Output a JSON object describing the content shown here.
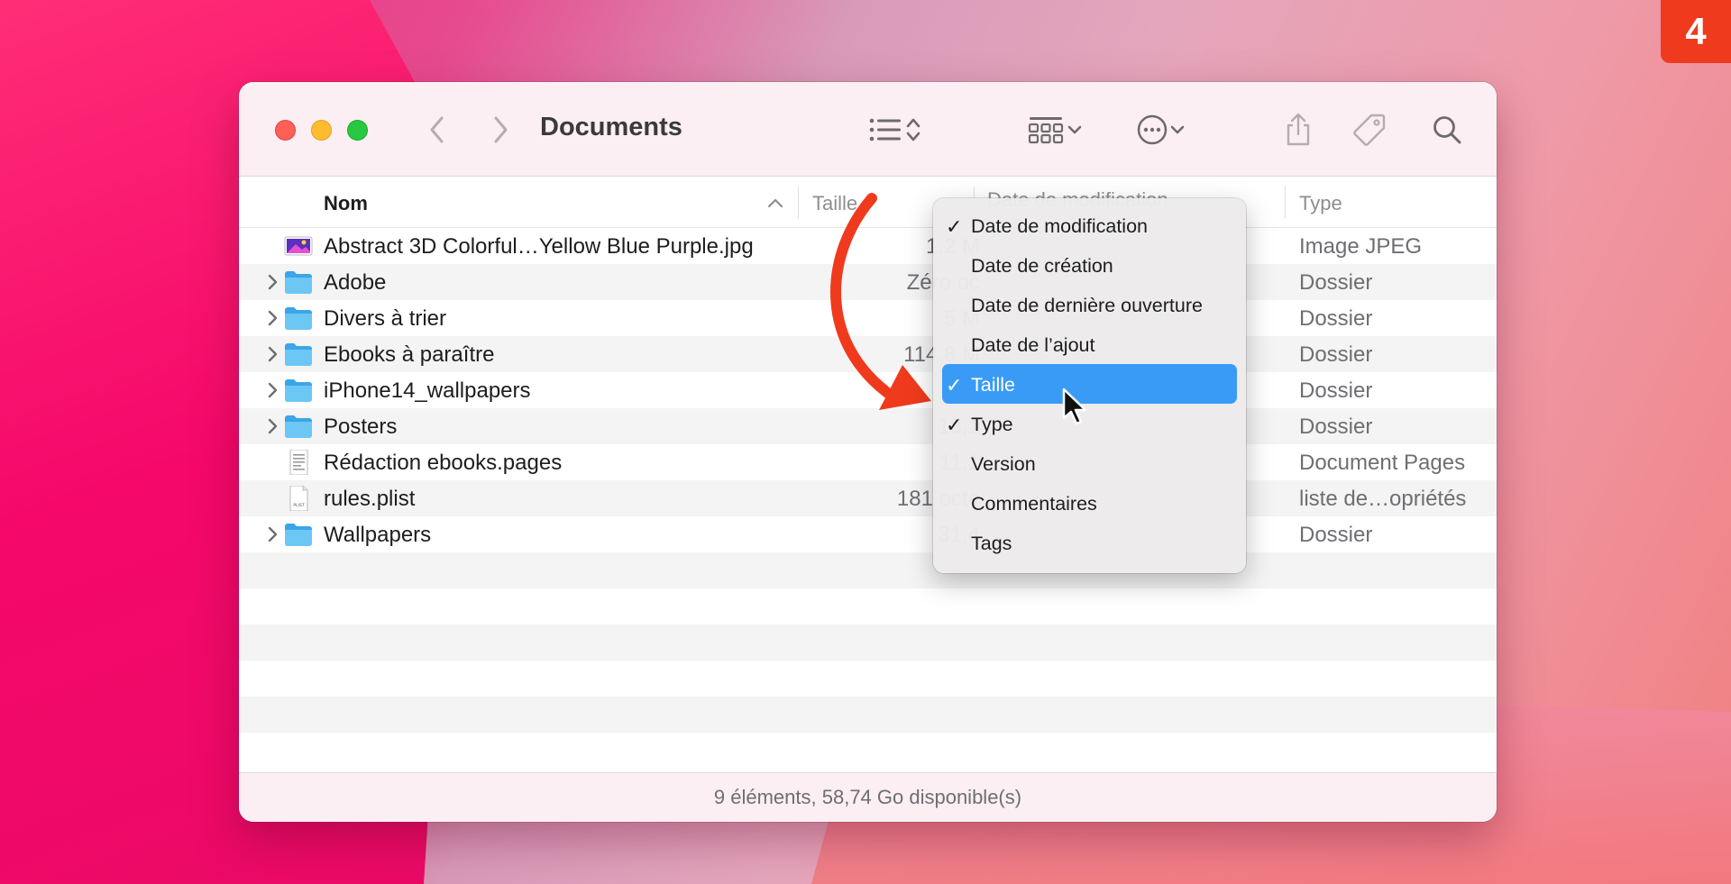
{
  "step_badge": "4",
  "window": {
    "title": "Documents",
    "status": "9 éléments, 58,74 Go disponible(s)"
  },
  "columns": {
    "name": "Nom",
    "size": "Taille",
    "date": "Date de modification",
    "kind": "Type"
  },
  "files": [
    {
      "name": "Abstract 3D Colorful…Yellow Blue Purple.jpg",
      "size": "1,2 M",
      "kind": "Image JPEG",
      "icon": "jpeg-image-icon",
      "folder": false
    },
    {
      "name": "Adobe",
      "size": "Zéro oc",
      "kind": "Dossier",
      "icon": "folder-icon",
      "folder": true
    },
    {
      "name": "Divers à trier",
      "size": "5 M",
      "kind": "Dossier",
      "icon": "folder-icon",
      "folder": true
    },
    {
      "name": "Ebooks à paraître",
      "size": "114,8 M",
      "kind": "Dossier",
      "icon": "folder-icon",
      "folder": true
    },
    {
      "name": "iPhone14_wallpapers",
      "size": "",
      "kind": "Dossier",
      "icon": "folder-icon",
      "folder": true
    },
    {
      "name": "Posters",
      "size": "13,1",
      "kind": "Dossier",
      "icon": "folder-icon",
      "folder": true
    },
    {
      "name": "Rédaction ebooks.pages",
      "size": "11,1",
      "kind": "Document Pages",
      "icon": "pages-document-icon",
      "folder": false
    },
    {
      "name": "rules.plist",
      "size": "181 octe",
      "kind": "liste de…opriétés",
      "icon": "plist-file-icon",
      "folder": false
    },
    {
      "name": "Wallpapers",
      "size": "31,4",
      "kind": "Dossier",
      "icon": "folder-icon",
      "folder": true
    }
  ],
  "menu": [
    {
      "label": "Date de modification",
      "checked": true,
      "selected": false
    },
    {
      "label": "Date de création",
      "checked": false,
      "selected": false
    },
    {
      "label": "Date de dernière ouverture",
      "checked": false,
      "selected": false
    },
    {
      "label": "Date de l’ajout",
      "checked": false,
      "selected": false
    },
    {
      "label": "Taille",
      "checked": true,
      "selected": true
    },
    {
      "label": "Type",
      "checked": true,
      "selected": false
    },
    {
      "label": "Version",
      "checked": false,
      "selected": false
    },
    {
      "label": "Commentaires",
      "checked": false,
      "selected": false
    },
    {
      "label": "Tags",
      "checked": false,
      "selected": false
    }
  ],
  "check_mark": "✓",
  "colors": {
    "accent": "#3a9bf6",
    "badge": "#f03a1d",
    "arrow": "#f03a1d"
  }
}
